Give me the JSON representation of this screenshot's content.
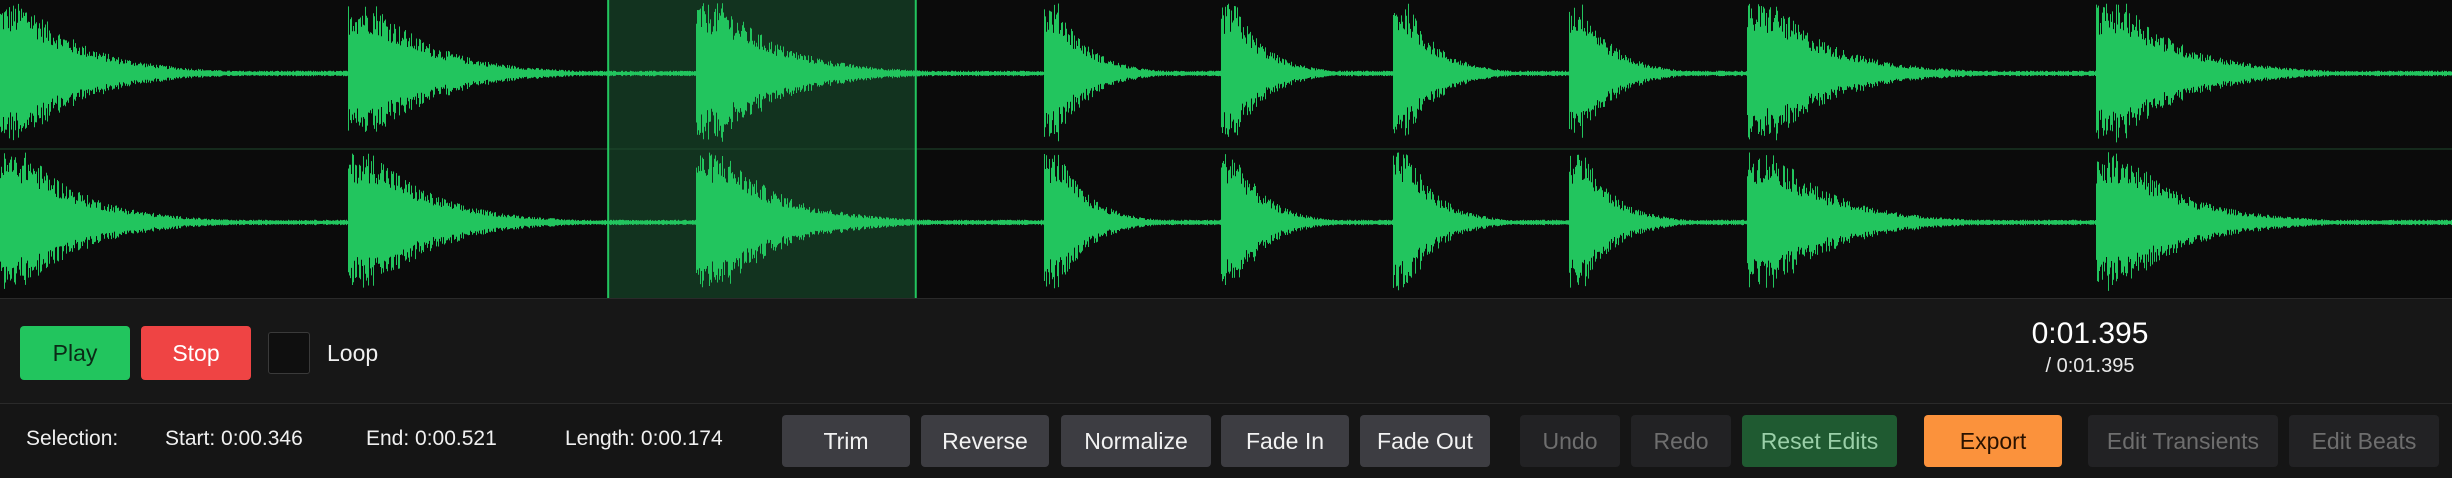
{
  "colors": {
    "waveform": "#22c55e",
    "selection_fill": "#12331f",
    "background": "#0b0b0b",
    "play": "#22c55e",
    "stop": "#ef4444",
    "export": "#fb923c",
    "reset": "#1f5a31"
  },
  "waveform": {
    "channels": 2,
    "duration_seconds": 1.395,
    "selection_start_seconds": 0.346,
    "selection_end_seconds": 0.521,
    "transient_onsets_seconds": [
      0.0,
      0.198,
      0.396,
      0.594,
      0.695,
      0.793,
      0.893,
      0.994,
      1.193
    ]
  },
  "transport": {
    "play_label": "Play",
    "stop_label": "Stop",
    "loop_label": "Loop",
    "loop_checked": false,
    "time_current": "0:01.395",
    "time_total": "/ 0:01.395"
  },
  "selection": {
    "title": "Selection:",
    "start": "Start: 0:00.346",
    "end": "End: 0:00.521",
    "length": "Length: 0:00.174"
  },
  "edit_buttons": {
    "trim": "Trim",
    "reverse": "Reverse",
    "normalize": "Normalize",
    "fade_in": "Fade In",
    "fade_out": "Fade Out",
    "undo": "Undo",
    "redo": "Redo",
    "reset": "Reset Edits",
    "export": "Export",
    "edit_transients": "Edit Transients",
    "edit_beats": "Edit Beats"
  }
}
